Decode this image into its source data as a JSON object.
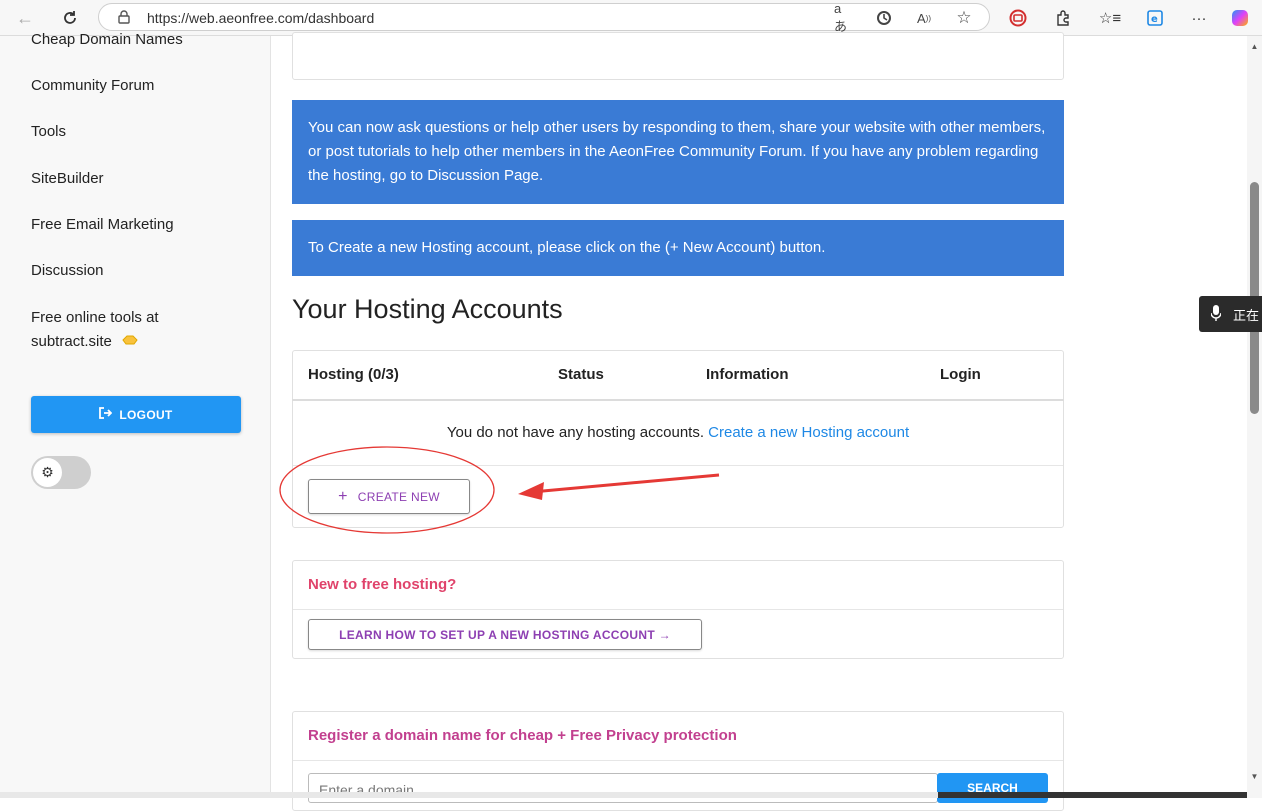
{
  "browser": {
    "url": "https://web.aeonfree.com/dashboard"
  },
  "sidebar": {
    "items": [
      {
        "label": "Cheap Domain Names"
      },
      {
        "label": "Community Forum"
      },
      {
        "label": "Tools"
      },
      {
        "label": "SiteBuilder"
      },
      {
        "label": "Free Email Marketing"
      },
      {
        "label": "Discussion"
      },
      {
        "label": "Free online tools at"
      },
      {
        "label": "subtract.site"
      }
    ],
    "logout_label": "LOGOUT"
  },
  "main": {
    "forum_banner": "You can now ask questions or help other users by responding to them, share your website with other members, or post tutorials to help other members in the AeonFree Community Forum. If you have any problem regarding the hosting, go to Discussion Page.",
    "create_banner": "To Create a new Hosting account, please click on the (+ New Account) button.",
    "heading": "Your Hosting Accounts",
    "table": {
      "columns": [
        "Hosting (0/3)",
        "Status",
        "Information",
        "Login"
      ],
      "empty_text": "You do not have any hosting accounts.",
      "empty_link": "Create a new Hosting account"
    },
    "create_new_label": "CREATE NEW",
    "new_hosting_title": "New to free hosting?",
    "learn_label": "LEARN HOW TO SET UP A NEW HOSTING ACCOUNT →",
    "domain_title": "Register a domain name for cheap + Free Privacy protection",
    "domain_input_placeholder": "Enter a domain",
    "domain_button_label": "SEARCH"
  },
  "voice_popup": {
    "text": "正在"
  },
  "colors": {
    "banner": "#3a7bd5",
    "logout": "#2196f3",
    "link": "#1e88e5",
    "pink_title": "#e0436b",
    "purple": "#8d3fb2",
    "annotation": "#e53935"
  }
}
